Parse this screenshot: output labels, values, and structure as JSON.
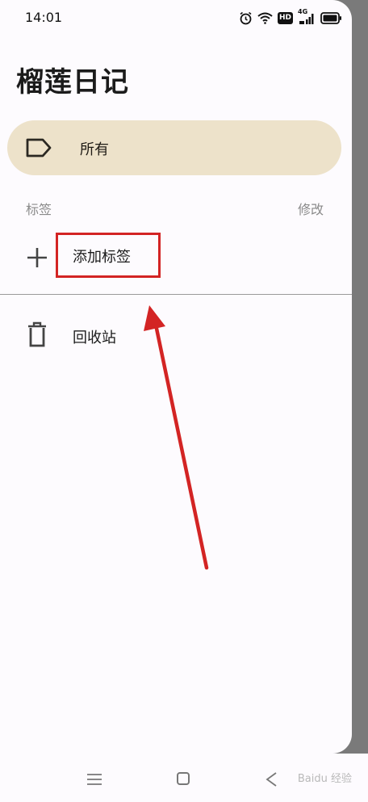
{
  "status_bar": {
    "time": "14:01",
    "icons": [
      "alarm-icon",
      "wifi-icon",
      "hd-badge",
      "4g-signal-icon",
      "battery-icon"
    ],
    "hd_label": "HD",
    "network_label": "4G"
  },
  "drawer": {
    "app_title": "榴莲日记",
    "all_item": {
      "label": "所有",
      "icon": "label-tag-icon"
    },
    "labels_header": "标签",
    "edit_labels": "修改",
    "add_label": {
      "label": "添加标签",
      "icon": "plus-icon"
    },
    "trash_item": {
      "label": "回收站",
      "icon": "trash-icon"
    }
  },
  "annotation": {
    "highlight_color": "#d32424",
    "arrow_color": "#d32424"
  },
  "nav_bar": {
    "icons": [
      "menu-icon",
      "home-icon",
      "back-icon"
    ],
    "watermark": "Baidu 经验"
  },
  "colors": {
    "drawer_background": "#fdfbfe",
    "selected_item_background": "#ede2ca",
    "scrim": "#7a7a7a"
  }
}
